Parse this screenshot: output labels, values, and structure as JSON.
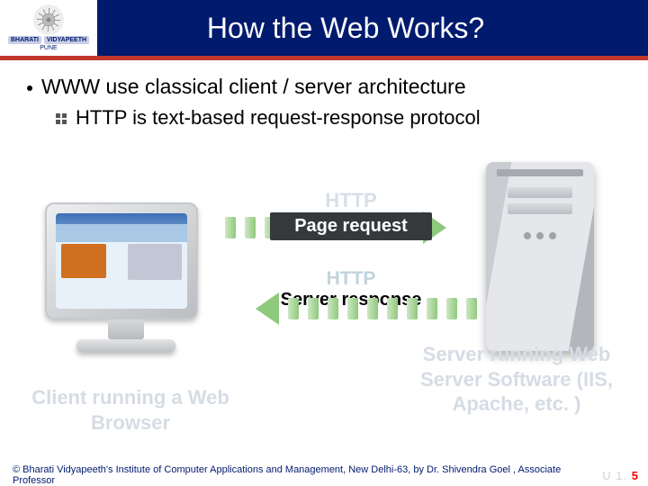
{
  "header": {
    "title": "How the Web Works?",
    "logo": {
      "name_left": "BHARATI",
      "name_right": "VIDYAPEETH",
      "city": "PUNE"
    }
  },
  "bullets": {
    "main": "WWW use classical client / server architecture",
    "sub": "HTTP is text-based request-response protocol"
  },
  "diagram": {
    "http_label_top": "HTTP",
    "page_request": "Page request",
    "http_label_bottom": "HTTP",
    "server_response": "Server response",
    "client_caption": "Client running a Web Browser",
    "server_caption": "Server running Web Server Software   (IIS, Apache, etc. )"
  },
  "footer": {
    "copyright": "© Bharati Vidyapeeth's Institute of Computer Applications and Management, New Delhi-63, by Dr. Shivendra Goel , Associate Professor",
    "page_prefix": "U 1.",
    "page_number": "5"
  }
}
